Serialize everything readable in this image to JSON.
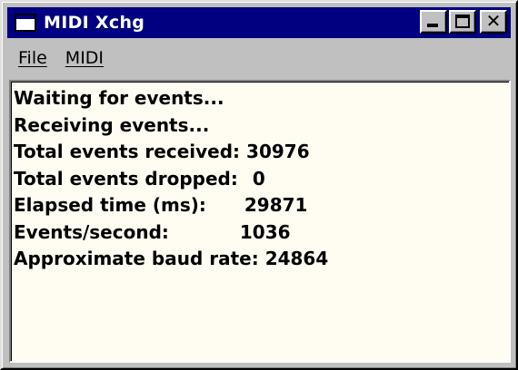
{
  "window": {
    "title": "MIDI Xchg"
  },
  "titlebar": {
    "minimize_icon": "minimize-icon",
    "maximize_icon": "maximize-icon",
    "close_icon": "close-icon",
    "close_glyph": "✕"
  },
  "menu": {
    "items": [
      {
        "label": "File"
      },
      {
        "label": "MIDI"
      }
    ]
  },
  "status": {
    "waiting": "Waiting for events...",
    "receiving": "Receiving events...",
    "total_received_label": "Total events received:",
    "total_received_value": "30976",
    "total_dropped_label": "Total events dropped:",
    "total_dropped_value": "0",
    "elapsed_label": "Elapsed time (ms):",
    "elapsed_value": "29871",
    "events_per_second_label": "Events/second:",
    "events_per_second_value": "1036",
    "baud_label": "Approximate baud rate:",
    "baud_value": "24864"
  },
  "colors": {
    "titlebar": "#000080",
    "face": "#c0c0c0",
    "content_bg": "#fffdf2"
  }
}
